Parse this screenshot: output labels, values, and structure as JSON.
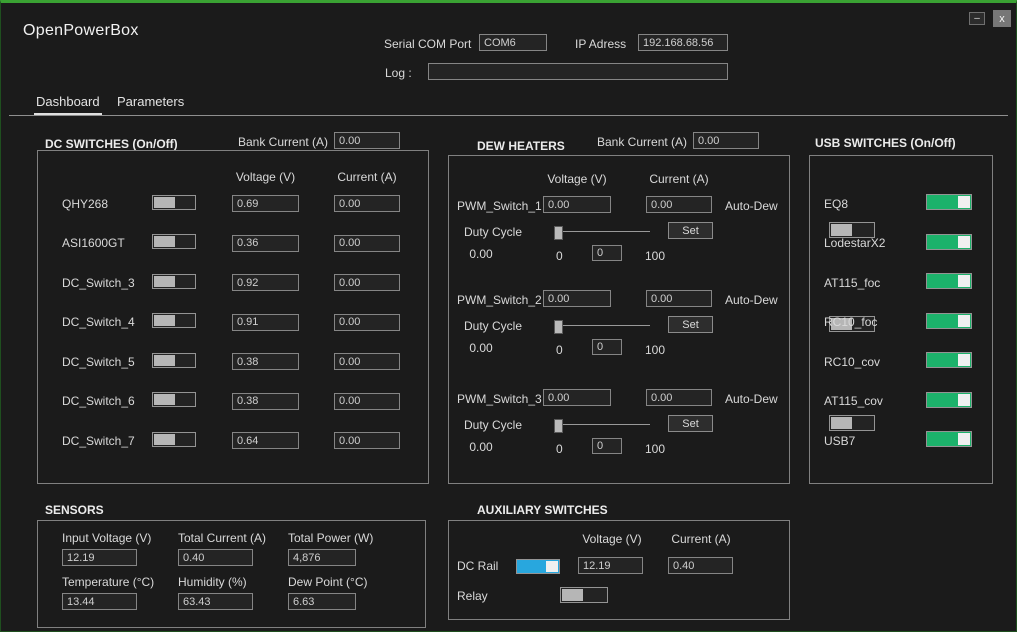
{
  "window": {
    "title": "OpenPowerBox",
    "minimize_label": "–",
    "close_label": "x"
  },
  "header": {
    "serial_label": "Serial COM Port",
    "serial_value": "COM6",
    "ip_label": "IP Adress",
    "ip_value": "192.168.68.56",
    "log_label": "Log :",
    "log_value": ""
  },
  "tabs": [
    {
      "label": "Dashboard"
    },
    {
      "label": "Parameters"
    }
  ],
  "dc_switches": {
    "title": "DC SWITCHES (On/Off)",
    "bank_current_label": "Bank Current (A)",
    "bank_current_value": "0.00",
    "col_voltage": "Voltage (V)",
    "col_current": "Current (A)",
    "rows": [
      {
        "label": "QHY268",
        "state": "off",
        "voltage": "0.69",
        "current": "0.00"
      },
      {
        "label": "ASI1600GT",
        "state": "off",
        "voltage": "0.36",
        "current": "0.00"
      },
      {
        "label": "DC_Switch_3",
        "state": "off",
        "voltage": "0.92",
        "current": "0.00"
      },
      {
        "label": "DC_Switch_4",
        "state": "off",
        "voltage": "0.91",
        "current": "0.00"
      },
      {
        "label": "DC_Switch_5",
        "state": "off",
        "voltage": "0.38",
        "current": "0.00"
      },
      {
        "label": "DC_Switch_6",
        "state": "off",
        "voltage": "0.38",
        "current": "0.00"
      },
      {
        "label": "DC_Switch_7",
        "state": "off",
        "voltage": "0.64",
        "current": "0.00"
      }
    ]
  },
  "dew_heaters": {
    "title": "DEW HEATERS",
    "bank_current_label": "Bank Current (A)",
    "bank_current_value": "0.00",
    "col_voltage": "Voltage (V)",
    "col_current": "Current (A)",
    "auto_dew_label": "Auto-Dew",
    "duty_cycle_label": "Duty Cycle",
    "set_label": "Set",
    "channels": [
      {
        "label": "PWM_Switch_1",
        "voltage": "0.00",
        "current": "0.00",
        "duty_value": "0.00",
        "range_min": "0",
        "duty_input": "0",
        "range_max": "100",
        "auto_dew_state": "off"
      },
      {
        "label": "PWM_Switch_2",
        "voltage": "0.00",
        "current": "0.00",
        "duty_value": "0.00",
        "range_min": "0",
        "duty_input": "0",
        "range_max": "100",
        "auto_dew_state": "off"
      },
      {
        "label": "PWM_Switch_3",
        "voltage": "0.00",
        "current": "0.00",
        "duty_value": "0.00",
        "range_min": "0",
        "duty_input": "0",
        "range_max": "100",
        "auto_dew_state": "off"
      }
    ]
  },
  "usb_switches": {
    "title": "USB SWITCHES (On/Off)",
    "rows": [
      {
        "label": "EQ8",
        "state": "on"
      },
      {
        "label": "LodestarX2",
        "state": "on"
      },
      {
        "label": "AT115_foc",
        "state": "on"
      },
      {
        "label": "RC10_foc",
        "state": "on"
      },
      {
        "label": "RC10_cov",
        "state": "on"
      },
      {
        "label": "AT115_cov",
        "state": "on"
      },
      {
        "label": "USB7",
        "state": "on"
      }
    ]
  },
  "sensors": {
    "title": "SENSORS",
    "fields": [
      {
        "label": "Input Voltage (V)",
        "value": "12.19"
      },
      {
        "label": "Total Current (A)",
        "value": "0.40"
      },
      {
        "label": "Total Power (W)",
        "value": "4,876"
      },
      {
        "label": "Temperature (°C)",
        "value": "13.44"
      },
      {
        "label": "Humidity (%)",
        "value": "63.43"
      },
      {
        "label": "Dew Point (°C)",
        "value": "6.63"
      }
    ]
  },
  "aux_switches": {
    "title": "AUXILIARY SWITCHES",
    "col_voltage": "Voltage (V)",
    "col_current": "Current (A)",
    "dc_rail": {
      "label": "DC Rail",
      "state": "on",
      "voltage": "12.19",
      "current": "0.40"
    },
    "relay": {
      "label": "Relay",
      "state": "off"
    }
  },
  "colors": {
    "window_border_green": "#3aa233",
    "toggle_on_green": "#1cb26b",
    "toggle_on_blue": "#28a7de"
  }
}
